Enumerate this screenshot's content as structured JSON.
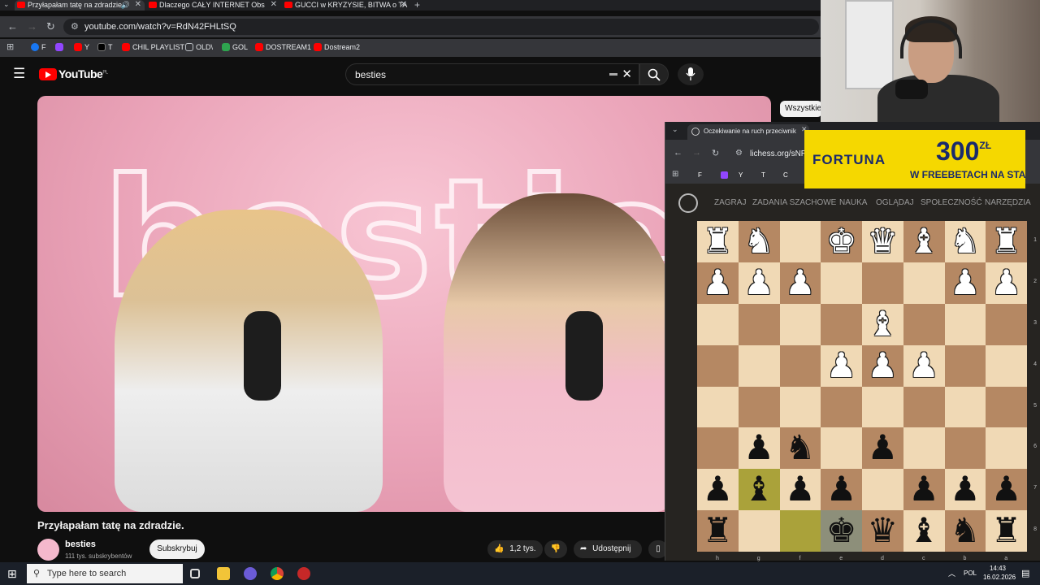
{
  "browser": {
    "tabs": [
      {
        "label": "Przyłapałam tatę na zdradzie",
        "active": true
      },
      {
        "label": "Dlaczego CAŁY INTERNET Obs",
        "active": false
      },
      {
        "label": "GUCCI w KRYZYSIE, BITWA o TA",
        "active": false
      }
    ],
    "new_tab": "+",
    "url": "youtube.com/watch?v=RdN42FHLtSQ",
    "bookmarks": [
      {
        "label": "F",
        "color": "#1877f2"
      },
      {
        "label": "",
        "color": "#9146ff"
      },
      {
        "label": "Y",
        "color": "#ff0000"
      },
      {
        "label": "T",
        "color": "#000000"
      },
      {
        "label": "CHIL PLAYLIST",
        "color": "#ff0000"
      },
      {
        "label": "OLD\\",
        "color": "#888888"
      },
      {
        "label": "GOL",
        "color": "#2ea44f"
      },
      {
        "label": "DOSTREAM1",
        "color": "#ff0000"
      },
      {
        "label": "Dostream2",
        "color": "#ff0000"
      }
    ]
  },
  "youtube": {
    "logo_text": "YouTube",
    "logo_region": "PL",
    "search_value": "besties",
    "filter_chip": "Wszystkie",
    "video_title": "Przyłapałam tatę na zdradzie.",
    "neon_sign": "besties",
    "channel_name": "besties",
    "channel_subs": "111 tys. subskrybentów",
    "subscribe_label": "Subskrybuj",
    "like_count": "1,2 tys.",
    "share_label": "Udostępnij"
  },
  "lichess": {
    "tab_title": "Oczekiwanie na ruch przeciwnik",
    "url": "lichess.org/sNRa",
    "bookmarks": [
      "F",
      "",
      "Y",
      "T",
      "C"
    ],
    "nav": [
      "ZAGRAJ",
      "ZADANIA SZACHOWE",
      "NAUKA",
      "OGLĄDAJ",
      "SPOŁECZNOŚĆ",
      "NARZĘDZIA"
    ],
    "ranks": [
      "1",
      "2",
      "3",
      "4",
      "5",
      "6",
      "7",
      "8"
    ],
    "files": [
      "h",
      "g",
      "f",
      "e",
      "d",
      "c",
      "b",
      "a"
    ],
    "board": [
      [
        "wR",
        "wN",
        "",
        "wK",
        "wQ",
        "wB",
        "wN",
        "wR"
      ],
      [
        "wP",
        "wP",
        "wP",
        "",
        "",
        "",
        "wP",
        "wP"
      ],
      [
        "",
        "",
        "",
        "",
        "wB",
        "",
        "",
        ""
      ],
      [
        "",
        "",
        "",
        "wP",
        "wP",
        "wP",
        "",
        ""
      ],
      [
        "",
        "",
        "",
        "",
        "",
        "",
        "",
        ""
      ],
      [
        "",
        "bP",
        "bN",
        "",
        "bP",
        "",
        "",
        ""
      ],
      [
        "bP",
        "bB",
        "bP",
        "bP",
        "",
        "bP",
        "bP",
        "bP"
      ],
      [
        "bR",
        "",
        "",
        "bK",
        "bQ",
        "bB",
        "bN",
        "bR"
      ]
    ],
    "highlight_squares": [
      [
        6,
        1
      ],
      [
        7,
        2
      ]
    ],
    "check_square": [
      7,
      3
    ]
  },
  "ad": {
    "brand": "FORTUNA",
    "amount": "300",
    "currency": "ZŁ",
    "slogan": "W FREEBETACH NA START"
  },
  "taskbar": {
    "search_placeholder": "Type here to search",
    "lang": "POL",
    "time": "14:43",
    "date": "16.02.2026"
  }
}
